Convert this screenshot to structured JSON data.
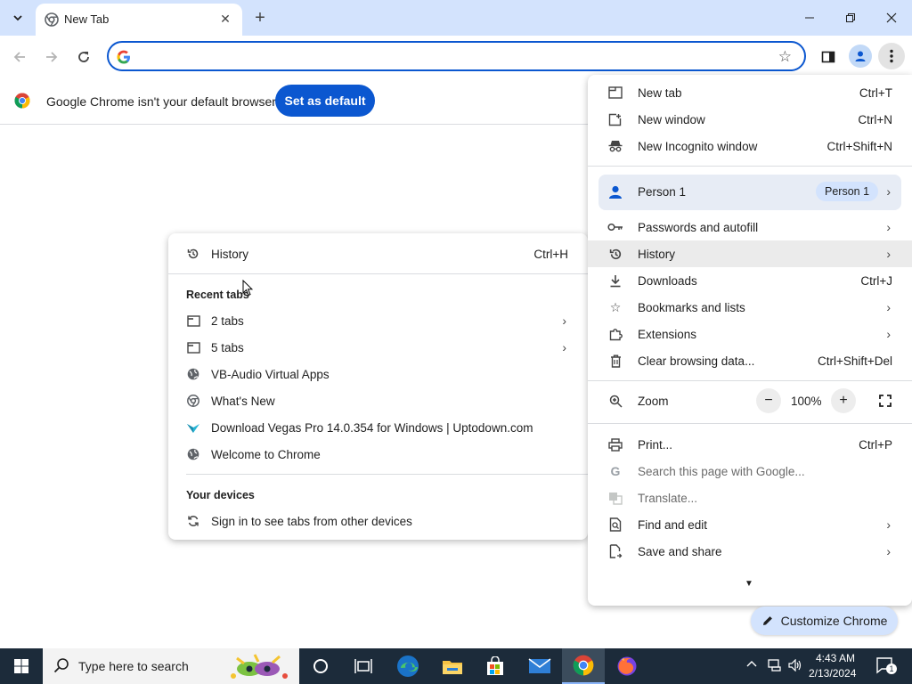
{
  "browser": {
    "tab_title": "New Tab",
    "omnibox_value": ""
  },
  "infobar": {
    "message": "Google Chrome isn't your default browser",
    "button_label": "Set as default"
  },
  "history_submenu": {
    "history_label": "History",
    "history_shortcut": "Ctrl+H",
    "recent_tabs_heading": "Recent tabs",
    "items": [
      {
        "label": "2 tabs",
        "icon": "window-icon",
        "has_submenu": true
      },
      {
        "label": "5 tabs",
        "icon": "window-icon",
        "has_submenu": true
      },
      {
        "label": "VB-Audio Virtual Apps",
        "icon": "globe-icon",
        "has_submenu": false
      },
      {
        "label": "What's New",
        "icon": "chrome-logo-icon",
        "has_submenu": false
      },
      {
        "label": "Download Vegas Pro 14.0.354 for Windows | Uptodown.com",
        "icon": "uptodown-icon",
        "has_submenu": false
      },
      {
        "label": "Welcome to Chrome",
        "icon": "globe-icon",
        "has_submenu": false
      }
    ],
    "devices_heading": "Your devices",
    "sign_in_label": "Sign in to see tabs from other devices"
  },
  "main_menu": {
    "new_tab": {
      "label": "New tab",
      "shortcut": "Ctrl+T"
    },
    "new_window": {
      "label": "New window",
      "shortcut": "Ctrl+N"
    },
    "new_incognito": {
      "label": "New Incognito window",
      "shortcut": "Ctrl+Shift+N"
    },
    "person": {
      "label": "Person 1",
      "badge": "Person 1"
    },
    "passwords": {
      "label": "Passwords and autofill"
    },
    "history": {
      "label": "History"
    },
    "downloads": {
      "label": "Downloads",
      "shortcut": "Ctrl+J"
    },
    "bookmarks": {
      "label": "Bookmarks and lists"
    },
    "extensions": {
      "label": "Extensions"
    },
    "clear_data": {
      "label": "Clear browsing data...",
      "shortcut": "Ctrl+Shift+Del"
    },
    "zoom": {
      "label": "Zoom",
      "value": "100%",
      "minus": "−",
      "plus": "+"
    },
    "print": {
      "label": "Print...",
      "shortcut": "Ctrl+P"
    },
    "search_page": {
      "label": "Search this page with Google..."
    },
    "translate": {
      "label": "Translate..."
    },
    "find_edit": {
      "label": "Find and edit"
    },
    "save_share": {
      "label": "Save and share"
    }
  },
  "customize": {
    "label": "Customize Chrome"
  },
  "taskbar": {
    "search_placeholder": "Type here to search",
    "time": "4:43 AM",
    "date": "2/13/2024",
    "notification_count": "1"
  },
  "colors": {
    "accent": "#0b57d0",
    "tabstrip": "#d3e3fd",
    "taskbar": "#1c2b3a"
  }
}
